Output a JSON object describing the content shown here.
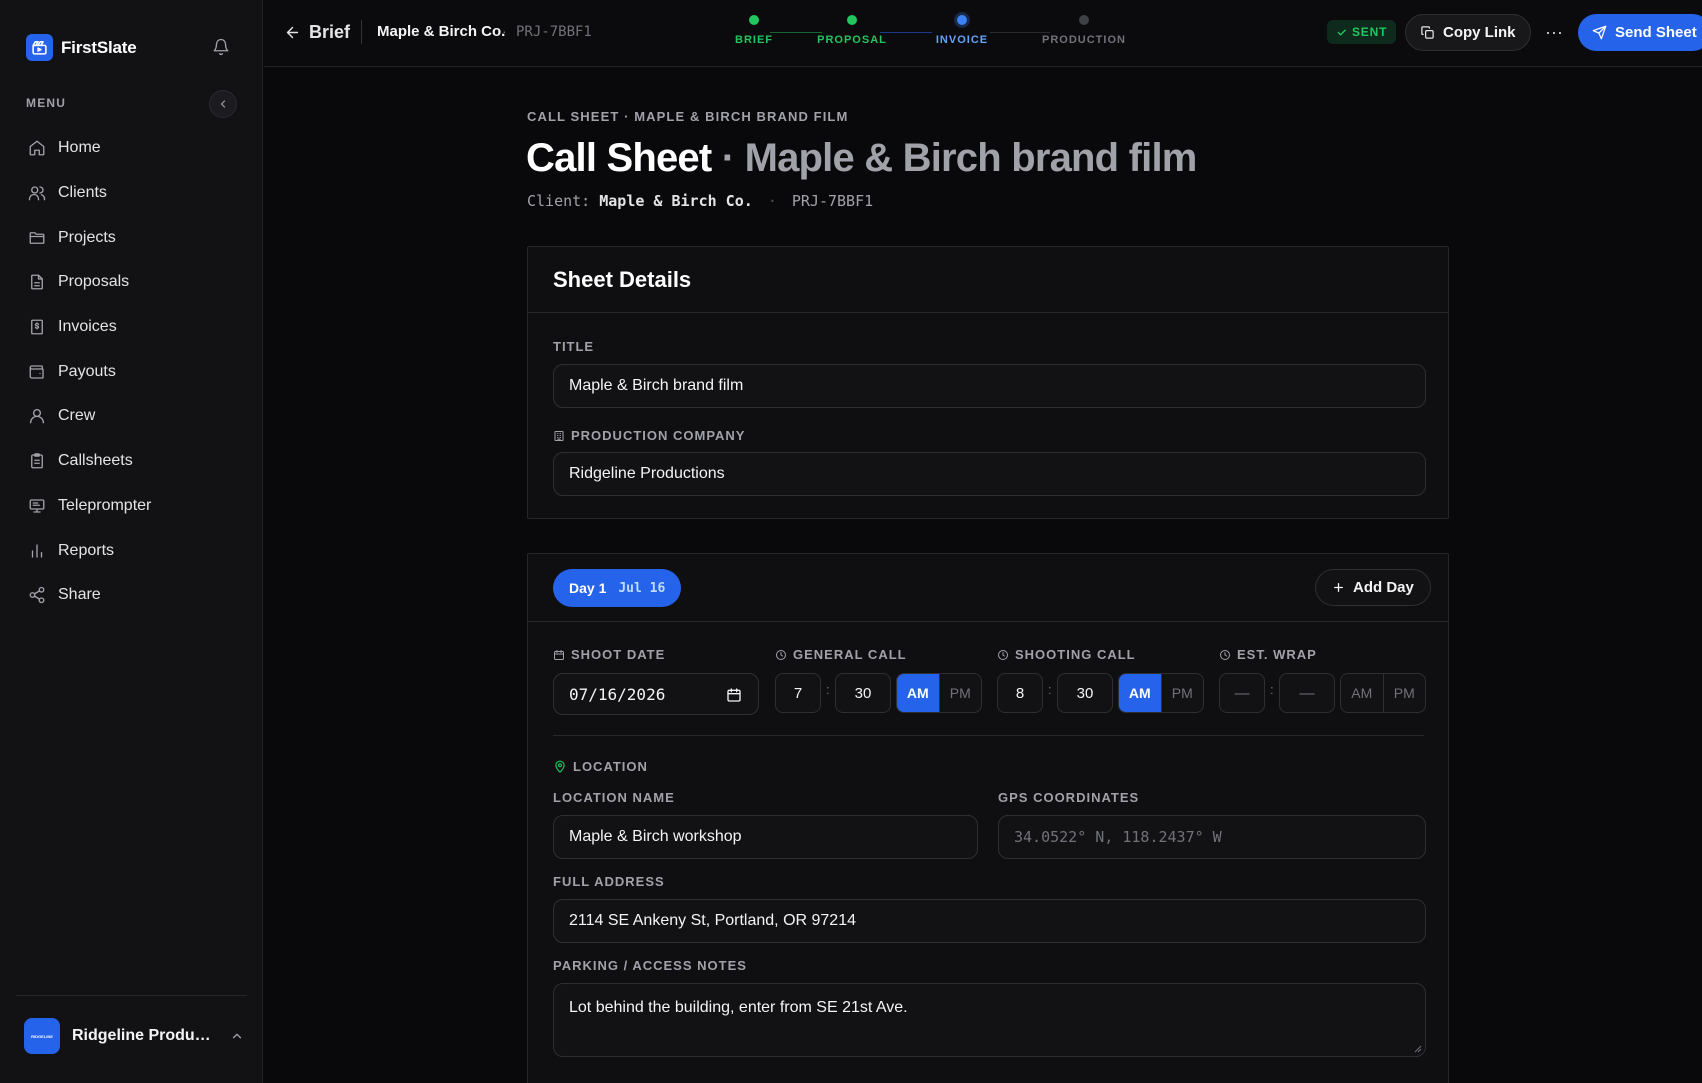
{
  "app": {
    "name": "FirstSlate"
  },
  "sidebar": {
    "menu_label": "MENU",
    "items": [
      {
        "label": "Home",
        "icon": "home-icon"
      },
      {
        "label": "Clients",
        "icon": "users-icon"
      },
      {
        "label": "Projects",
        "icon": "folder-icon"
      },
      {
        "label": "Proposals",
        "icon": "document-icon"
      },
      {
        "label": "Invoices",
        "icon": "invoice-icon"
      },
      {
        "label": "Payouts",
        "icon": "wallet-icon"
      },
      {
        "label": "Crew",
        "icon": "user-icon"
      },
      {
        "label": "Callsheets",
        "icon": "clipboard-icon"
      },
      {
        "label": "Teleprompter",
        "icon": "monitor-icon"
      },
      {
        "label": "Reports",
        "icon": "bar-chart-icon"
      },
      {
        "label": "Share",
        "icon": "share-icon"
      }
    ],
    "account": {
      "name": "Ridgeline Productions",
      "avatar_text": "RIDGELINE"
    }
  },
  "topbar": {
    "back_label": "Brief",
    "client": "Maple & Birch Co.",
    "separator": "·",
    "project_code": "PRJ-7BBF1",
    "steps": [
      {
        "label": "BRIEF",
        "state": "done"
      },
      {
        "label": "PROPOSAL",
        "state": "done"
      },
      {
        "label": "INVOICE",
        "state": "current"
      },
      {
        "label": "PRODUCTION",
        "state": "todo"
      }
    ],
    "status_badge": "SENT",
    "copy_link": "Copy Link",
    "more": "···",
    "send": "Send Sheet"
  },
  "header": {
    "eyebrow": "CALL SHEET · MAPLE & BIRCH BRAND FILM",
    "title_main": "Call Sheet",
    "title_sep": " · ",
    "title_sub": "Maple & Birch brand film",
    "client_label": "Client:",
    "client_value": "Maple & Birch Co.",
    "dot": "·",
    "code": "PRJ-7BBF1"
  },
  "details": {
    "heading": "Sheet Details",
    "title_label": "TITLE",
    "title_value": "Maple & Birch brand film",
    "company_label": "PRODUCTION COMPANY",
    "company_value": "Ridgeline Productions"
  },
  "day": {
    "chip_label": "Day 1",
    "chip_date": "Jul 16",
    "add_day": "Add Day",
    "shoot_date_label": "SHOOT DATE",
    "shoot_date_value": "07/16/2026",
    "general_call_label": "GENERAL CALL",
    "general_call": {
      "hour": "7",
      "minute": "30",
      "period": "AM"
    },
    "shooting_call_label": "SHOOTING CALL",
    "shooting_call": {
      "hour": "8",
      "minute": "30",
      "period": "AM"
    },
    "wrap_label": "EST. WRAP",
    "wrap": {
      "hour": "—",
      "minute": "—",
      "period": ""
    },
    "am": "AM",
    "pm": "PM",
    "colon": ":",
    "location_heading": "LOCATION",
    "location_name_label": "LOCATION NAME",
    "location_name_value": "Maple & Birch workshop",
    "gps_label": "GPS COORDINATES",
    "gps_placeholder": "34.0522° N, 118.2437° W",
    "address_label": "FULL ADDRESS",
    "address_value": "2114 SE Ankeny St, Portland, OR 97214",
    "parking_label": "PARKING / ACCESS NOTES",
    "parking_value": "Lot behind the building, enter from SE 21st Ave."
  },
  "colors": {
    "accent": "#2563eb",
    "success": "#22c55e",
    "background": "#09090b",
    "sidebar": "#121215"
  }
}
